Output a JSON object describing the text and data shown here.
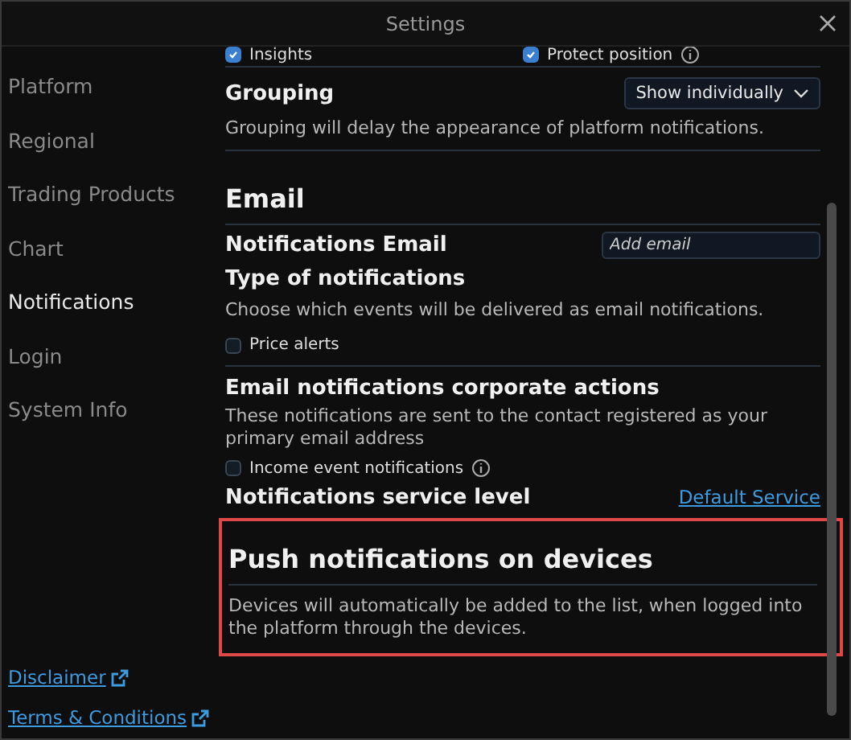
{
  "window": {
    "title": "Settings"
  },
  "sidebar": {
    "items": [
      {
        "label": "Platform",
        "selected": false
      },
      {
        "label": "Regional",
        "selected": false
      },
      {
        "label": "Trading Products",
        "selected": false
      },
      {
        "label": "Chart",
        "selected": false
      },
      {
        "label": "Notifications",
        "selected": true
      },
      {
        "label": "Login",
        "selected": false
      },
      {
        "label": "System Info",
        "selected": false
      }
    ],
    "links": [
      "Disclaimer",
      "Terms & Conditions"
    ]
  },
  "top_options": [
    {
      "label": "Insights",
      "checked": true,
      "info": false
    },
    {
      "label": "Protect position",
      "checked": true,
      "info": true
    }
  ],
  "grouping": {
    "title": "Grouping",
    "value": "Show individually",
    "description": "Grouping will delay the appearance of platform notifications."
  },
  "email": {
    "title": "Email",
    "notifications_email": {
      "label": "Notifications Email",
      "placeholder": "Add email"
    },
    "type": {
      "title": "Type of notifications",
      "description": "Choose which events will be delivered as email notifications.",
      "options": [
        {
          "label": "Price alerts",
          "checked": false,
          "info": false
        }
      ]
    },
    "corporate": {
      "title": "Email notifications corporate actions",
      "description": "These notifications are sent to the contact registered as your primary email address",
      "options": [
        {
          "label": "Income event notifications",
          "checked": false,
          "info": true
        }
      ]
    },
    "service_level": {
      "label": "Notifications service level",
      "link": "Default Service"
    }
  },
  "push": {
    "title": "Push notifications on devices",
    "description": "Devices will automatically be added to the list, when logged into the platform through the devices.",
    "highlighted": true
  }
}
